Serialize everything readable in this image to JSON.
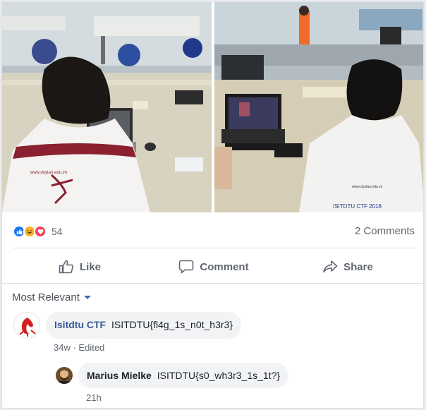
{
  "post": {
    "reactions": {
      "icons": [
        "like-icon",
        "haha-icon",
        "love-icon"
      ],
      "count": "54"
    },
    "comments_count": "2 Comments",
    "images": [
      {
        "visible_text": "www.duytan.edu.vn"
      },
      {
        "visible_text": "www.duytan.edu.vn",
        "visible_text_2": "ISITDTU CTF 2018"
      }
    ]
  },
  "actions": {
    "like": "Like",
    "comment": "Comment",
    "share": "Share"
  },
  "comments_section": {
    "sort_label": "Most Relevant",
    "comments": [
      {
        "author": "Isitdtu CTF",
        "text": "ISITDTU{fl4g_1s_n0t_h3r3}",
        "time": "34w",
        "edited": "· Edited"
      }
    ],
    "replies": [
      {
        "author": "Marius Mielke",
        "text": "ISITDTU{s0_wh3r3_1s_1t?}",
        "time": "21h"
      }
    ]
  },
  "colors": {
    "accent": "#385898",
    "like": "#1877f2",
    "love": "#f33e58",
    "haha": "#f7b125"
  }
}
